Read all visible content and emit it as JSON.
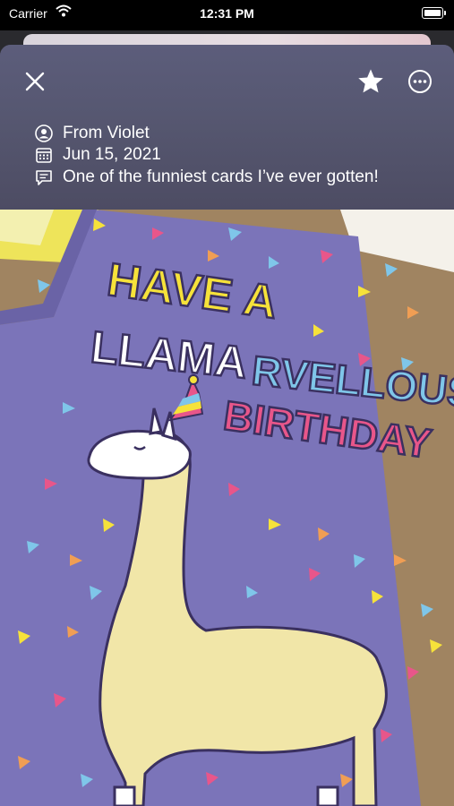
{
  "status_bar": {
    "carrier": "Carrier",
    "time": "12:31 PM"
  },
  "toolbar": {
    "close_icon": "close-icon",
    "favorite_icon": "star-icon",
    "more_icon": "ellipsis-circle-icon"
  },
  "card": {
    "from": "From Violet",
    "date": "Jun 15, 2021",
    "note": "One of the funniest cards I’ve ever gotten!"
  },
  "photo": {
    "line1": "HAVE A",
    "line2a": "LLAMA",
    "line2b": "RVELLOUS",
    "line3": "BIRTHDAY"
  },
  "colors": {
    "card_purple": "#7a73b8",
    "text_yellow": "#f6e23a",
    "text_blue": "#7fc6e9",
    "text_pink": "#e8568a",
    "llama": "#f1e6a8"
  }
}
